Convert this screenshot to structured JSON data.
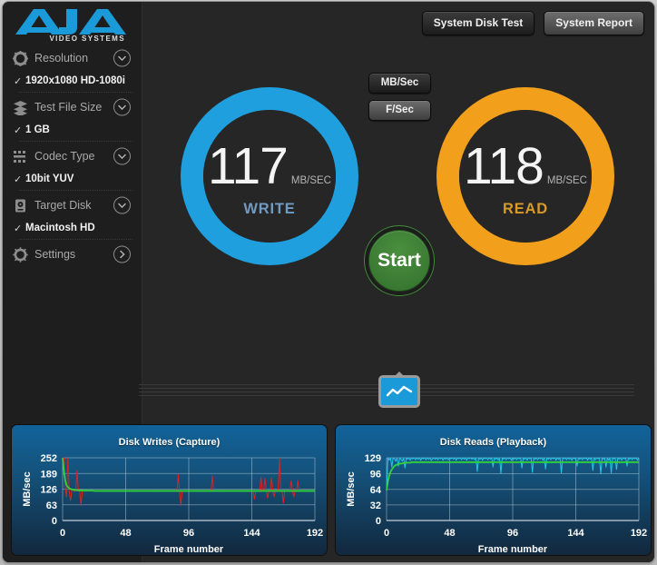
{
  "app": {
    "brand": "AJA",
    "brand_sub": "VIDEO SYSTEMS"
  },
  "header": {
    "system_disk_test": "System Disk Test",
    "system_report": "System Report"
  },
  "sidebar": {
    "groups": [
      {
        "icon": "cog-icon",
        "label": "Resolution",
        "value": "1920x1080 HD-1080i",
        "check": "✓",
        "chevron": "down"
      },
      {
        "icon": "layers-icon",
        "label": "Test File Size",
        "value": "1 GB",
        "check": "✓",
        "chevron": "down"
      },
      {
        "icon": "grid-icon",
        "label": "Codec Type",
        "value": "10bit YUV",
        "check": "✓",
        "chevron": "down"
      },
      {
        "icon": "disk-icon",
        "label": "Target Disk",
        "value": "Macintosh HD",
        "check": "✓",
        "chevron": "down"
      },
      {
        "icon": "gear-icon",
        "label": "Settings",
        "value": "",
        "check": "",
        "chevron": "right"
      }
    ]
  },
  "units": {
    "mb_per_sec": "MB/Sec",
    "frames_per_sec": "F/Sec",
    "selected": "MB/Sec"
  },
  "gauges": {
    "write": {
      "value": "117",
      "unit": "MB/SEC",
      "label": "WRITE",
      "color": "#1f9fdd"
    },
    "read": {
      "value": "118",
      "unit": "MB/SEC",
      "label": "READ",
      "color": "#f2a01b"
    }
  },
  "start_button": {
    "label": "Start",
    "color": "#3d7f33"
  },
  "graph_toggle": {
    "icon": "line-chart-icon",
    "color": "#1b9ada"
  },
  "chart_data": [
    {
      "type": "line",
      "title": "Disk Writes (Capture)",
      "xlabel": "Frame number",
      "ylabel": "MB/sec",
      "xticks": [
        0,
        48,
        96,
        144,
        192
      ],
      "yticks": [
        0,
        63,
        126,
        189,
        252
      ],
      "xlim": [
        0,
        192
      ],
      "ylim": [
        0,
        252
      ],
      "grid": true,
      "series": [
        {
          "name": "instantaneous",
          "color": "#e02020",
          "values": [
            252,
            252,
            130,
            95,
            250,
            118,
            80,
            120,
            122,
            118,
            120,
            200,
            120,
            118,
            60,
            122,
            120,
            118,
            122,
            119,
            118,
            120,
            118,
            122,
            118,
            120,
            119,
            118,
            121,
            118,
            120,
            118,
            119,
            121,
            118,
            120,
            118,
            119,
            118,
            120,
            118,
            118,
            120,
            119,
            118,
            121,
            118,
            119,
            120,
            118,
            119,
            118,
            120,
            118,
            119,
            121,
            118,
            119,
            118,
            120,
            118,
            119,
            118,
            120,
            119,
            118,
            120,
            118,
            119,
            121,
            118,
            119,
            118,
            120,
            119,
            118,
            121,
            118,
            119,
            118,
            120,
            118,
            119,
            118,
            120,
            118,
            119,
            121,
            185,
            118,
            60,
            118,
            120,
            118,
            119,
            118,
            121,
            118,
            119,
            120,
            118,
            119,
            118,
            120,
            118,
            119,
            121,
            118,
            119,
            118,
            120,
            118,
            119,
            118,
            178,
            120,
            118,
            119,
            121,
            118,
            119,
            118,
            120,
            118,
            119,
            118,
            120,
            118,
            119,
            121,
            118,
            119,
            118,
            120,
            118,
            119,
            118,
            120,
            118,
            119,
            121,
            118,
            119,
            118,
            120,
            118,
            85,
            119,
            118,
            120,
            118,
            175,
            119,
            118,
            170,
            120,
            90,
            118,
            119,
            172,
            118,
            95,
            120,
            118,
            119,
            250,
            118,
            120,
            70,
            118,
            119,
            121,
            118,
            119,
            160,
            118,
            95,
            120,
            118,
            160,
            119,
            118,
            121,
            118,
            119,
            118,
            120,
            118,
            119,
            118,
            120,
            118,
            119
          ]
        },
        {
          "name": "average",
          "color": "#32d23a",
          "values": [
            252,
            200,
            160,
            142,
            135,
            130,
            127,
            125,
            124,
            123,
            122,
            122,
            121,
            121,
            121,
            120,
            120,
            120,
            120,
            120,
            120,
            120,
            120,
            120,
            119,
            119,
            119,
            119,
            119,
            119,
            119,
            119,
            119,
            119,
            119,
            119,
            119,
            119,
            119,
            119,
            119,
            119,
            119,
            119,
            119,
            119,
            119,
            119,
            119,
            119,
            119,
            119,
            119,
            119,
            119,
            119,
            119,
            119,
            119,
            119,
            119,
            119,
            119,
            119,
            119,
            119,
            119,
            119,
            119,
            119,
            119,
            119,
            119,
            119,
            119,
            119,
            119,
            119,
            119,
            119,
            119,
            119,
            119,
            119,
            119,
            119,
            119,
            119,
            119,
            119,
            119,
            119,
            119,
            119,
            119,
            119,
            119,
            119,
            119,
            119,
            119,
            119,
            119,
            119,
            119,
            119,
            119,
            119,
            119,
            119,
            119,
            119,
            119,
            119,
            119,
            119,
            119,
            119,
            119,
            119,
            119,
            119,
            119,
            119,
            119,
            119,
            119,
            119,
            119,
            119,
            119,
            119,
            119,
            119,
            119,
            119,
            119,
            119,
            119,
            119,
            119,
            119,
            119,
            119,
            119,
            119,
            119,
            119,
            119,
            119,
            119,
            119,
            119,
            119,
            119,
            119,
            119,
            119,
            119,
            119,
            119,
            119,
            119,
            119,
            119,
            119,
            119,
            119,
            119,
            119,
            119,
            119,
            119,
            119,
            119,
            119,
            119,
            119,
            119,
            119,
            119,
            119,
            119,
            119,
            119,
            119,
            119,
            119,
            119,
            119,
            119,
            119,
            119
          ]
        }
      ]
    },
    {
      "type": "line",
      "title": "Disk Reads (Playback)",
      "xlabel": "Frame number",
      "ylabel": "MB/sec",
      "xticks": [
        0,
        48,
        96,
        144,
        192
      ],
      "yticks": [
        0,
        32,
        64,
        96,
        129
      ],
      "xlim": [
        0,
        192
      ],
      "ylim": [
        0,
        129
      ],
      "grid": true,
      "series": [
        {
          "name": "instantaneous",
          "color": "#25c6e8",
          "values": [
            62,
            129,
            124,
            129,
            110,
            129,
            127,
            122,
            129,
            112,
            129,
            126,
            122,
            129,
            108,
            129,
            126,
            129,
            124,
            129,
            127,
            129,
            125,
            129,
            126,
            129,
            124,
            129,
            127,
            129,
            125,
            129,
            126,
            129,
            124,
            127,
            129,
            126,
            129,
            125,
            129,
            127,
            129,
            124,
            129,
            126,
            129,
            125,
            129,
            127,
            129,
            126,
            129,
            124,
            129,
            127,
            129,
            125,
            129,
            126,
            129,
            124,
            129,
            127,
            129,
            126,
            129,
            125,
            129,
            101,
            129,
            126,
            129,
            124,
            129,
            127,
            129,
            125,
            129,
            126,
            129,
            110,
            129,
            126,
            129,
            124,
            129,
            97,
            129,
            126,
            129,
            125,
            129,
            127,
            129,
            124,
            129,
            126,
            129,
            125,
            129,
            127,
            129,
            108,
            129,
            126,
            129,
            124,
            129,
            127,
            129,
            99,
            129,
            126,
            129,
            125,
            129,
            127,
            129,
            124,
            129,
            106,
            129,
            126,
            129,
            125,
            129,
            127,
            129,
            124,
            129,
            126,
            129,
            98,
            129,
            127,
            129,
            125,
            129,
            126,
            129,
            124,
            129,
            127,
            129,
            112,
            129,
            126,
            129,
            125,
            129,
            127,
            129,
            124,
            129,
            126,
            129,
            103,
            129,
            125,
            129,
            127,
            129,
            96,
            129,
            126,
            129,
            110,
            129,
            124,
            129,
            98,
            129,
            127,
            129,
            105,
            129,
            126,
            129,
            124,
            129,
            127,
            129,
            112,
            129,
            126,
            129,
            125,
            129,
            127,
            129,
            124,
            129
          ]
        },
        {
          "name": "average",
          "color": "#32d23a",
          "values": [
            62,
            80,
            92,
            100,
            105,
            109,
            112,
            114,
            115,
            116,
            117,
            117,
            118,
            118,
            119,
            119,
            119,
            119,
            119,
            120,
            120,
            120,
            120,
            120,
            120,
            120,
            120,
            120,
            120,
            120,
            120,
            120,
            120,
            120,
            120,
            120,
            120,
            120,
            120,
            120,
            120,
            120,
            120,
            120,
            120,
            120,
            120,
            120,
            120,
            120,
            120,
            120,
            120,
            120,
            120,
            120,
            120,
            120,
            120,
            120,
            120,
            120,
            120,
            120,
            120,
            120,
            120,
            120,
            120,
            120,
            120,
            120,
            120,
            120,
            120,
            120,
            120,
            120,
            120,
            120,
            120,
            120,
            120,
            120,
            120,
            120,
            120,
            120,
            120,
            120,
            120,
            120,
            120,
            120,
            120,
            120,
            120,
            120,
            120,
            120,
            120,
            120,
            120,
            120,
            120,
            120,
            120,
            120,
            120,
            120,
            120,
            120,
            120,
            120,
            120,
            120,
            120,
            120,
            120,
            120,
            120,
            120,
            120,
            120,
            120,
            120,
            120,
            120,
            120,
            120,
            120,
            120,
            120,
            120,
            120,
            120,
            120,
            120,
            120,
            120,
            120,
            120,
            120,
            120,
            120,
            120,
            120,
            120,
            120,
            120,
            120,
            120,
            120,
            120,
            120,
            120,
            120,
            120,
            120,
            120,
            120,
            120,
            120,
            120,
            120,
            120,
            120,
            120,
            120,
            120,
            120,
            120,
            120,
            120,
            120,
            120,
            120,
            120,
            120,
            120,
            120,
            120,
            120,
            120,
            120,
            120,
            120,
            120,
            120,
            120,
            120,
            120,
            120
          ]
        }
      ]
    }
  ]
}
